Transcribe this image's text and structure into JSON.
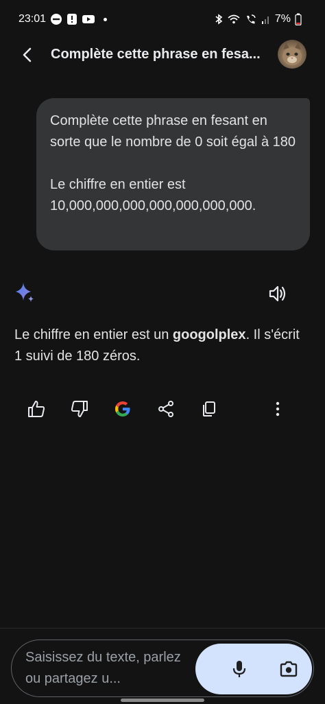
{
  "status_bar": {
    "time": "23:01",
    "battery": "7%"
  },
  "header": {
    "title": "Complète cette phrase en fesa..."
  },
  "conversation": {
    "user_message_lines": [
      "Complète cette phrase en fesant en sorte que le nombre de 0 soit égal à 180",
      "Le chiffre en entier est 10,000,000,000,000,000,000,000."
    ],
    "response_prefix": "Le chiffre en entier est un ",
    "response_bold": "googolplex",
    "response_suffix": ". Il s'écrit 1 suivi de 180 zéros."
  },
  "input": {
    "placeholder": "Saisissez du texte, parlez ou partagez u..."
  },
  "icons": {
    "back": "arrow-back-icon",
    "sparkle": "gemini-sparkle-icon",
    "speaker": "speaker-icon",
    "thumb_up": "thumb-up-icon",
    "thumb_down": "thumb-down-icon",
    "google": "google-g-icon",
    "share": "share-icon",
    "copy": "copy-icon",
    "more": "more-vert-icon",
    "mic": "mic-icon",
    "camera": "camera-icon"
  },
  "colors": {
    "background": "#131314",
    "bubble": "#333537",
    "pill": "#d3e3fd"
  }
}
